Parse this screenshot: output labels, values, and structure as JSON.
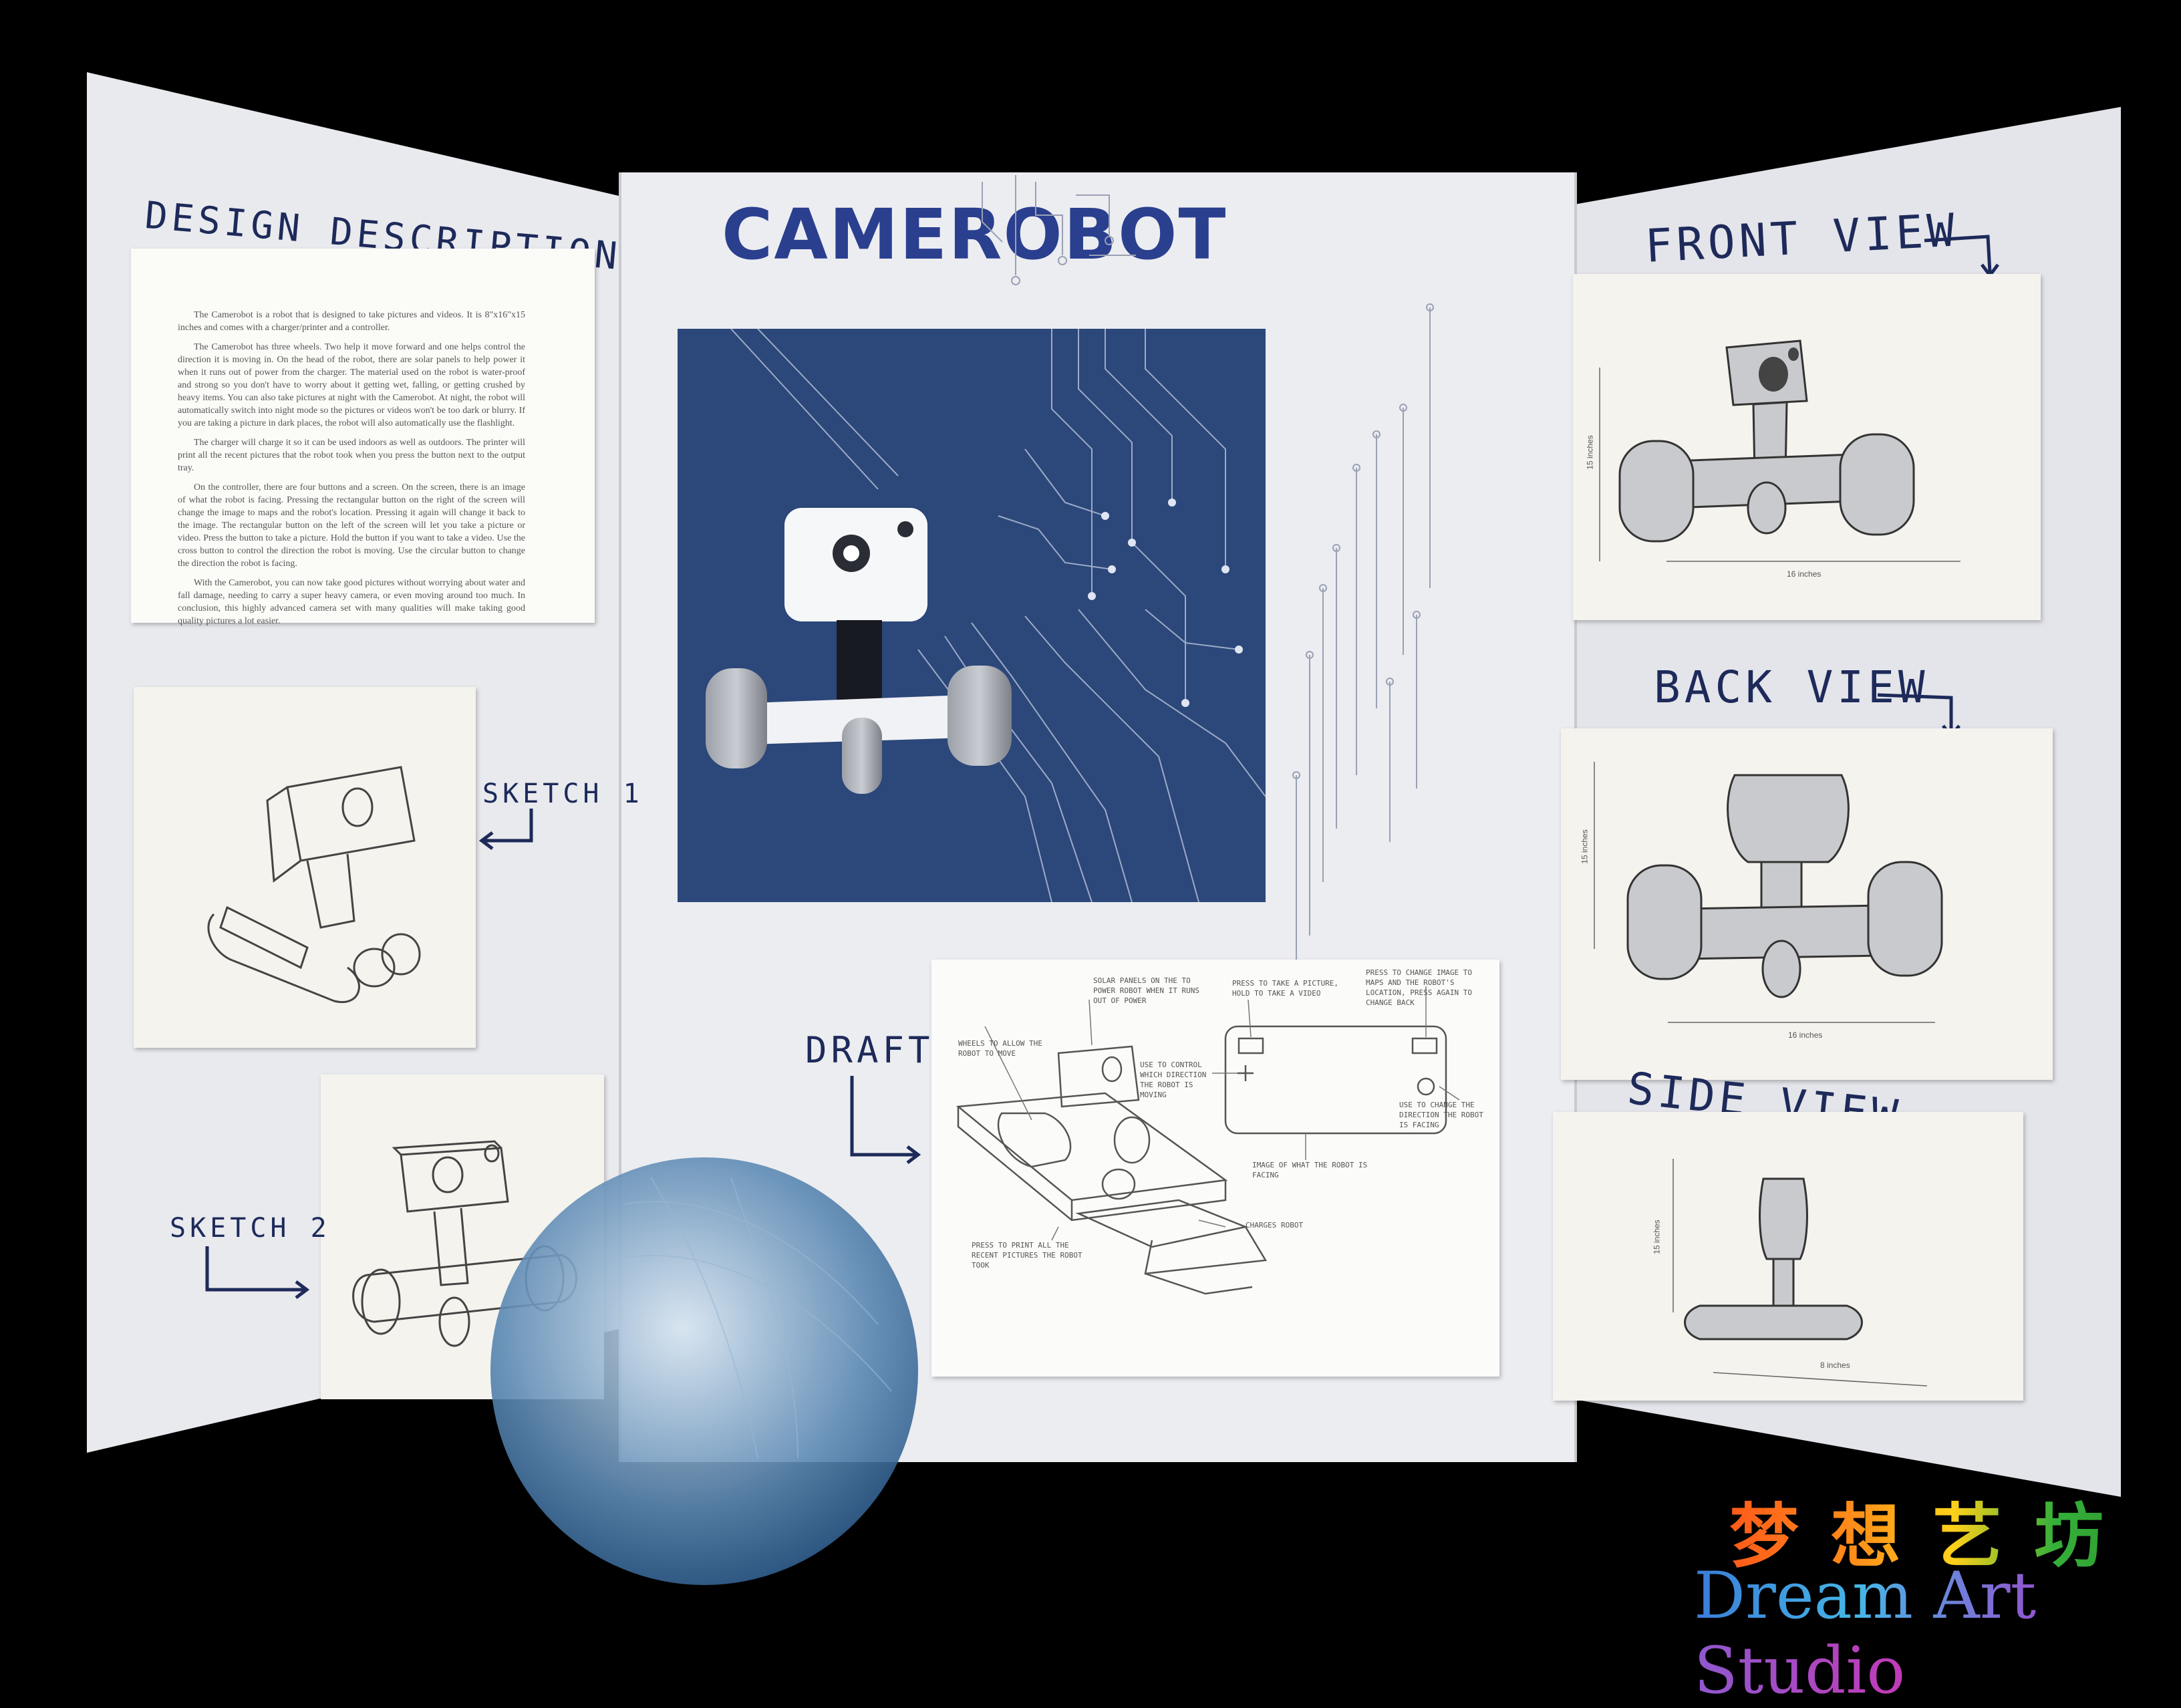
{
  "board": {
    "title": "Camerobot",
    "design_heading": "Design Description",
    "design_paragraphs": [
      "The Camerobot is a robot that is designed to take pictures and videos. It is 8\"x16\"x15 inches and comes with a charger/printer and a controller.",
      "The Camerobot has three wheels. Two help it move forward and one helps control the direction it is moving in. On the head of the robot, there are solar panels to help power it when it runs out of power from the charger. The material used on the robot is water-proof and strong so you don't have to worry about it getting wet, falling, or getting crushed by heavy items. You can also take pictures at night with the Camerobot. At night, the robot will automatically switch into night mode so the pictures or videos won't be too dark or blurry. If you are taking a picture in dark places, the robot will also automatically use the flashlight.",
      "The charger will charge it so it can be used indoors as well as outdoors. The printer will print all the recent pictures that the robot took when you press the button next to the output tray.",
      "On the controller, there are four buttons and a screen. On the screen, there is an image of what the robot is facing. Pressing the rectangular button on the right of the screen will change the image to maps and the robot's location. Pressing it again will change it back to the image. The rectangular button on the left of the screen will let you take a picture or video. Press the button to take a picture. Hold the button if you want to take a video. Use the cross button to control the direction the robot is moving. Use the circular button to change the direction the robot is facing.",
      "With the Camerobot, you can now take good pictures without worrying about water and fall damage, needing to carry a super heavy camera, or even moving around too much. In conclusion, this highly advanced camera set with many qualities will make taking good quality pictures a lot easier."
    ],
    "sketch1_label": "SKETCH 1",
    "sketch2_label": "SKETCH 2",
    "draft_label": "DRAFT",
    "front_view_label": "Front View",
    "back_view_label": "Back View",
    "side_view_label": "Side View",
    "draft_notes": {
      "solar": "SOLAR PANELS ON THE TO POWER ROBOT WHEN IT RUNS OUT OF POWER",
      "wheels": "WHEELS TO ALLOW THE ROBOT TO MOVE",
      "press_take": "PRESS TO TAKE A PICTURE, HOLD TO TAKE A VIDEO",
      "press_change": "PRESS TO CHANGE IMAGE TO MAPS AND THE ROBOT'S LOCATION, PRESS AGAIN TO CHANGE BACK",
      "use_control": "USE TO CONTROL WHICH DIRECTION THE ROBOT IS MOVING",
      "use_change": "USE TO CHANGE THE DIRECTION THE ROBOT IS FACING",
      "image_of": "IMAGE OF WHAT THE ROBOT IS FACING",
      "charges": "CHARGES ROBOT",
      "press_print": "PRESS TO PRINT ALL THE RECENT PICTURES THE ROBOT TOOK"
    },
    "dimensions": {
      "front_height": "15 inches",
      "front_width": "16 inches",
      "back_height": "15 inches",
      "back_width": "16 inches",
      "side_height": "15 inches",
      "side_width": "8 inches"
    }
  },
  "watermark": {
    "chinese": "梦想艺坊",
    "english": "Dream Art Studio"
  },
  "colors": {
    "background": "#000000",
    "board": "#e7e8ec",
    "ink_blue": "#1d2a5a",
    "poster_blue": "#2c4779",
    "title_blue": "#2b3f8f"
  }
}
